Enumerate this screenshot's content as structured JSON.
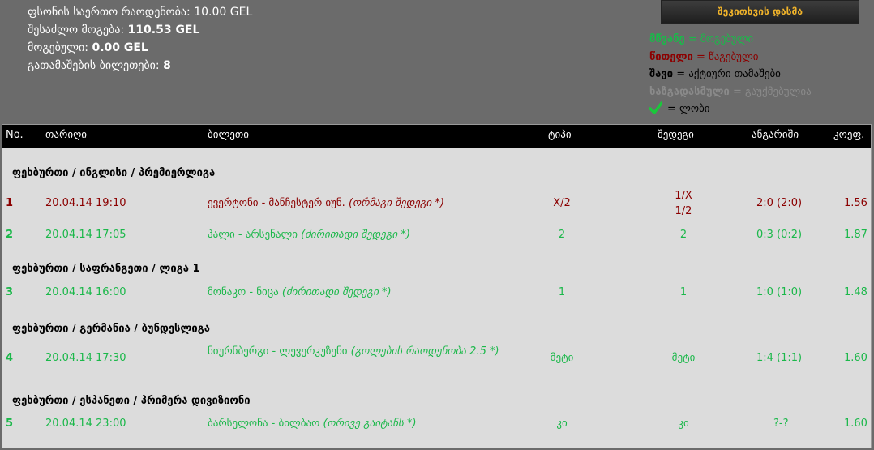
{
  "summary": {
    "total_stake_label": "ფსონის საერთო რაოდენობა:",
    "total_stake_value": "10.00 GEL",
    "possible_win_label": "შესაძლო მოგება:",
    "possible_win_value": "110.53 GEL",
    "won_label": "მოგებული:",
    "won_value": "0.00 GEL",
    "tickets_played_label": "გათამაშების ბილეთები:",
    "tickets_played_value": "8"
  },
  "submit_button": "შეკითხვის დასმა",
  "legend": {
    "green_word": "მწვანე",
    "green_desc": "= მოგებული",
    "red_word": "წითელი",
    "red_desc": "= წაგებული",
    "black_word": "შავი",
    "black_desc": "= აქტიური თამაშები",
    "grey_word": "ხაზგადასმული",
    "grey_desc": "= გაუქმებულია",
    "check_desc": "= ლობი"
  },
  "colors": {
    "green": "#1bb84a",
    "red": "#8b0000",
    "button_text": "#f0b32a"
  },
  "table": {
    "headers": {
      "no": "No.",
      "date": "თარიღი",
      "ticket": "ბილეთი",
      "type": "ტიპი",
      "result": "შედეგი",
      "score": "ანგარიში",
      "odds": "კოეფ."
    },
    "groups": [
      "ფეხბურთი / ინგლისი / პრემიერლიგა",
      "ფეხბურთი / საფრანგეთი / ლიგა 1",
      "ფეხბურთი / გერმანია / ბუნდესლიგა",
      "ფეხბურთი / ესპანეთი / პრიმერა დივიზიონი"
    ],
    "rows": [
      {
        "no": "1",
        "date": "20.04.14 19:10",
        "teams": "ევერტონი - მანჩესტერ იუნ.",
        "market": "(ორმაგი შედეგი *)",
        "type": "X/2",
        "result_1": "1/X",
        "result_2": "1/2",
        "score": "2:0 (2:0)",
        "odds": "1.56",
        "status": "lost"
      },
      {
        "no": "2",
        "date": "20.04.14 17:05",
        "teams": "ჰალი - არსენალი",
        "market": "(ძირითადი შედეგი *)",
        "type": "2",
        "result": "2",
        "score": "0:3 (0:2)",
        "odds": "1.87",
        "status": "won"
      },
      {
        "no": "3",
        "date": "20.04.14 16:00",
        "teams": "მონაკო - ნიცა",
        "market": "(ძირითადი შედეგი *)",
        "type": "1",
        "result": "1",
        "score": "1:0 (1:0)",
        "odds": "1.48",
        "status": "won"
      },
      {
        "no": "4",
        "date": "20.04.14 17:30",
        "teams": "ნიურნბერგი - ლევერკუზენი",
        "market": "(გოლების რაოდენობა 2.5 *)",
        "type": "მეტი",
        "result": "მეტი",
        "score": "1:4 (1:1)",
        "odds": "1.60",
        "status": "won"
      },
      {
        "no": "5",
        "date": "20.04.14 23:00",
        "teams": "ბარსელონა - ბილბაო",
        "market": "(ორივე გაიტანს *)",
        "type": "კი",
        "result": "კი",
        "score": "?-?",
        "odds": "1.60",
        "status": "won"
      }
    ]
  }
}
